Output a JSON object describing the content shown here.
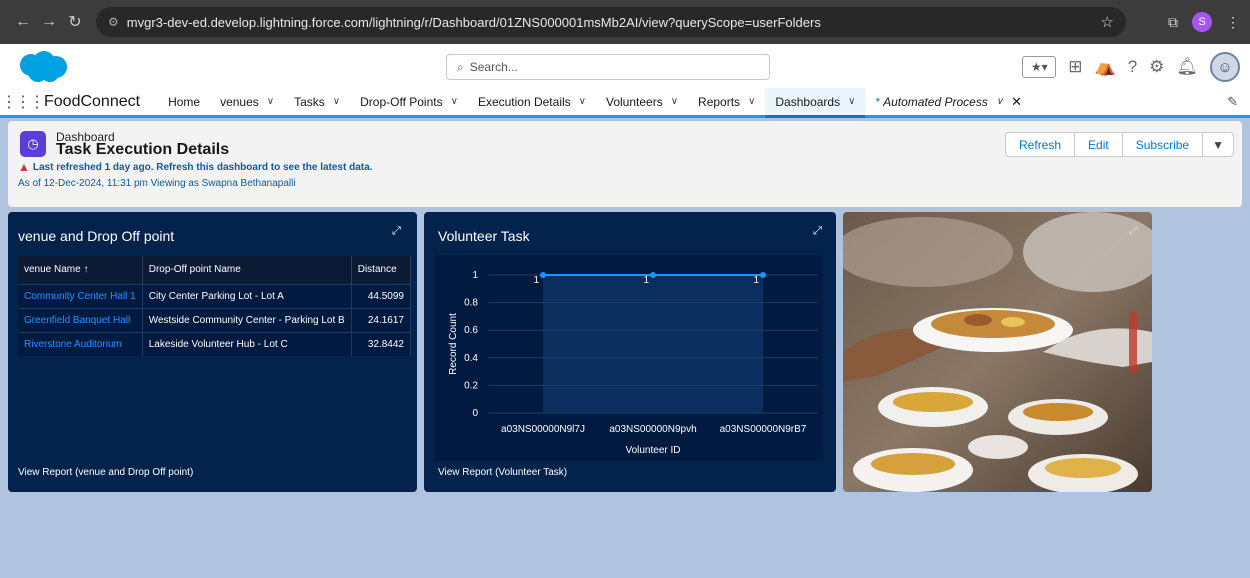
{
  "browser": {
    "url": "mvgr3-dev-ed.develop.lightning.force.com/lightning/r/Dashboard/01ZNS000001msMb2AI/view?queryScope=userFolders",
    "profile_initial": "S"
  },
  "header": {
    "search_placeholder": "Search..."
  },
  "nav": {
    "app_name": "FoodConnect",
    "items": [
      {
        "label": "Home"
      },
      {
        "label": "venues"
      },
      {
        "label": "Tasks"
      },
      {
        "label": "Drop-Off Points"
      },
      {
        "label": "Execution Details"
      },
      {
        "label": "Volunteers"
      },
      {
        "label": "Reports"
      },
      {
        "label": "Dashboards"
      }
    ],
    "open_tab": "Automated Process"
  },
  "dashboard": {
    "kind": "Dashboard",
    "title": "Task Execution Details",
    "warning": "Last refreshed 1 day ago. Refresh this dashboard to see the latest data.",
    "as_of": "As of 12-Dec-2024, 11:31 pm Viewing as Swapna Bethanapalli",
    "buttons": {
      "refresh": "Refresh",
      "edit": "Edit",
      "subscribe": "Subscribe"
    }
  },
  "venue_card": {
    "title": "venue and Drop Off point",
    "columns": [
      "venue Name ↑",
      "Drop-Off point Name",
      "Distance"
    ],
    "rows": [
      [
        "Community Center Hall 1",
        "City Center Parking Lot - Lot A",
        "44.5099"
      ],
      [
        "Greenfield Banquet Hall",
        "Westside Community Center - Parking Lot B",
        "24.1617"
      ],
      [
        "Riverstone Auditorium",
        "Lakeside Volunteer Hub - Lot C",
        "32.8442"
      ]
    ],
    "footer": "View Report (venue and Drop Off point)"
  },
  "volunteer_card": {
    "title": "Volunteer Task",
    "footer": "View Report (Volunteer Task)"
  },
  "colors": {
    "card_bg": "#03234d",
    "accent": "#1b96ff",
    "series": "#1b96ff"
  },
  "chart_data": {
    "type": "line",
    "title": "Volunteer Task",
    "xlabel": "Volunteer ID",
    "ylabel": "Record Count",
    "categories": [
      "a03NS00000N9l7J",
      "a03NS00000N9pvh",
      "a03NS00000N9rB7"
    ],
    "values": [
      1,
      1,
      1
    ],
    "data_labels": [
      "1",
      "1",
      "1"
    ],
    "ylim": [
      0,
      1
    ],
    "yticks": [
      "0",
      "0.2",
      "0.4",
      "0.6",
      "0.8",
      "1"
    ]
  }
}
